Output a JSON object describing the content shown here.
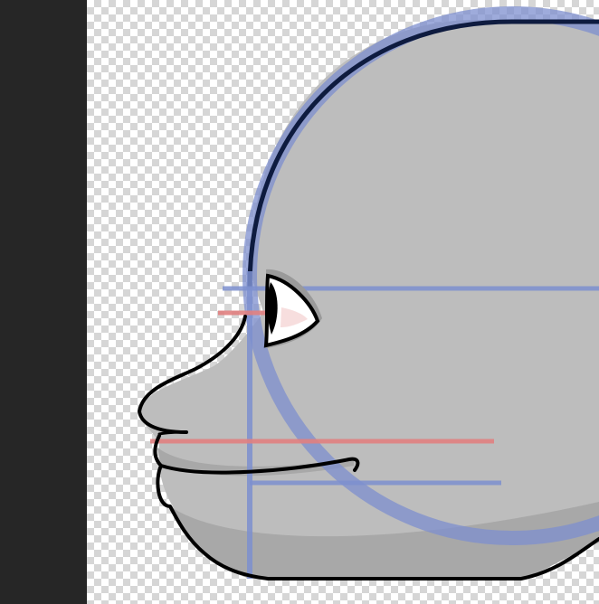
{
  "app": {
    "canvas_background": "transparent-checkerboard",
    "panel_color": "#262626"
  },
  "artwork": {
    "subject": "side-profile-head-sketch",
    "colors": {
      "skin": "#bdbdbd",
      "shadow": "#a6a6a6",
      "outline": "#000000",
      "skull_circle": "#0e1b3f",
      "guide_blue": "#7d8fcf",
      "guide_red": "#e08080",
      "eye_white": "#ffffff",
      "iris": "#000000",
      "eye_socket": "#9a9a9a"
    }
  }
}
